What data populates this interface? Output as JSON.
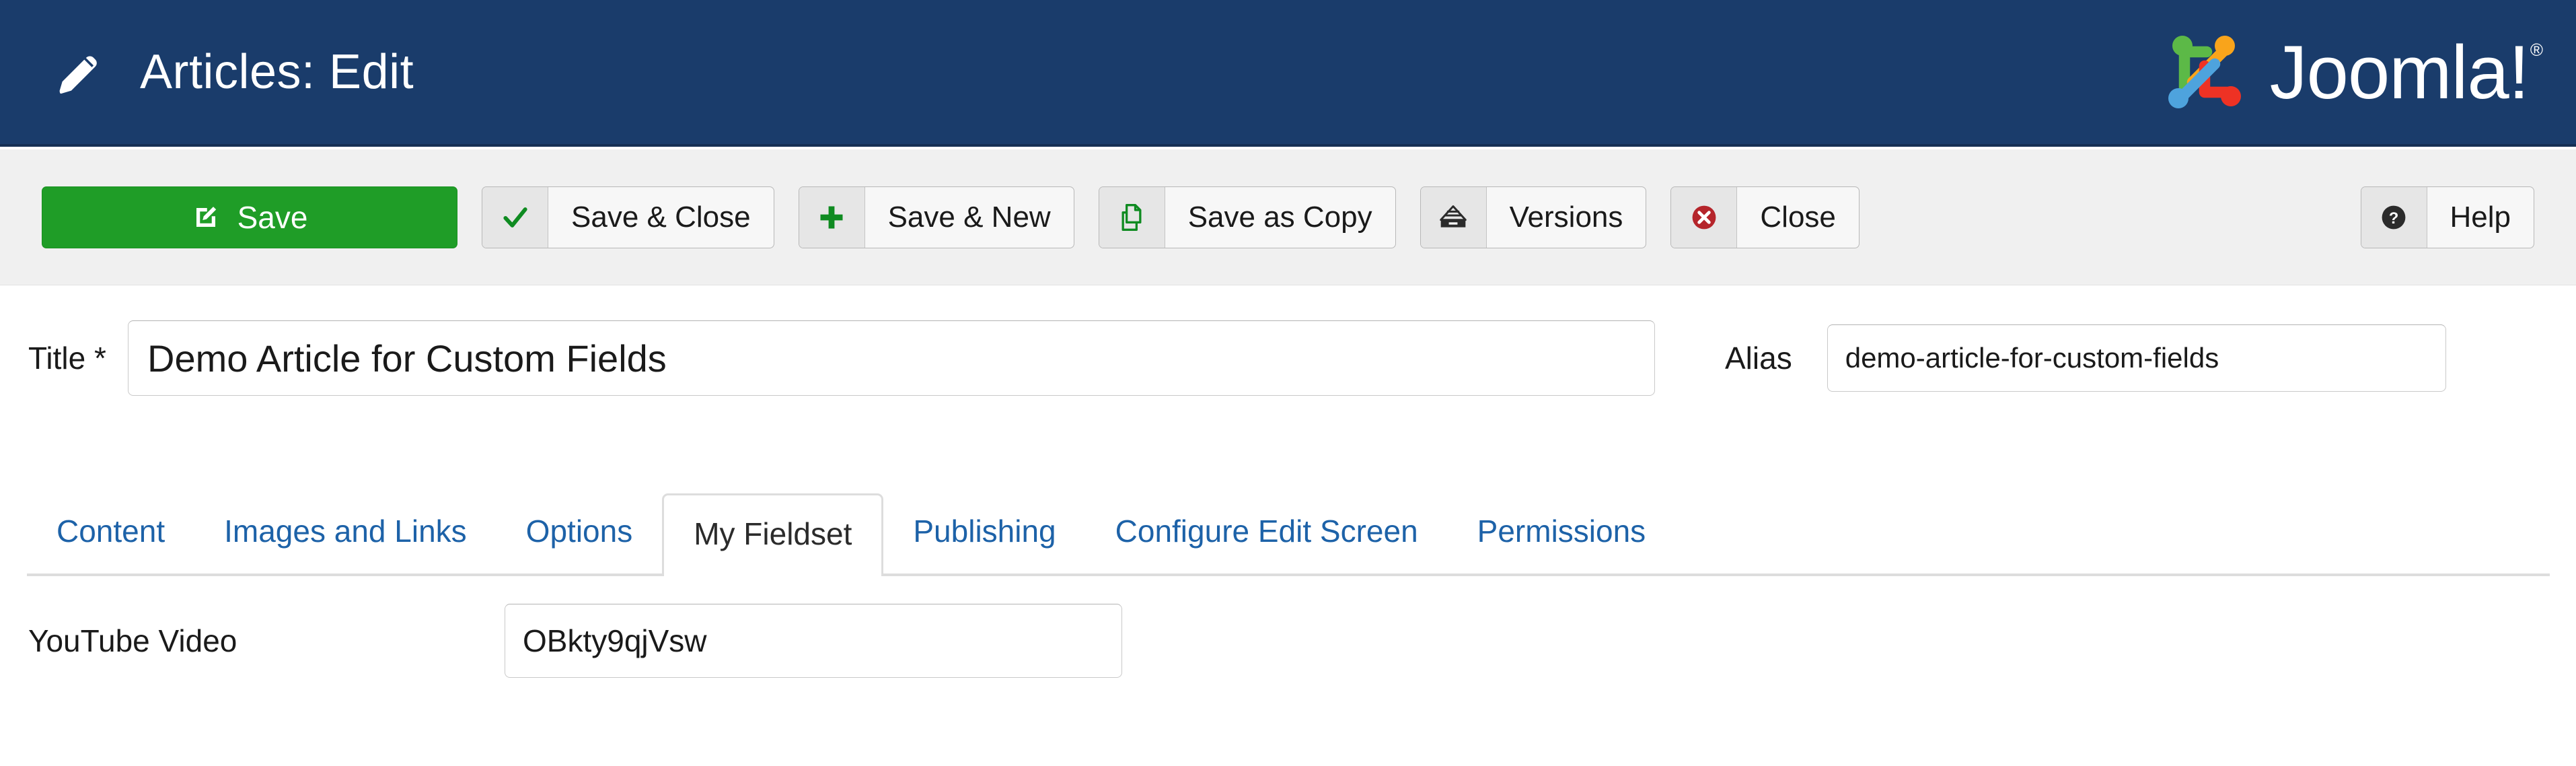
{
  "header": {
    "title": "Articles: Edit",
    "icon": "pencil-icon",
    "brand": "Joomla!",
    "brand_trademark": "®",
    "background_color": "#1a3c6b"
  },
  "toolbar": {
    "save": {
      "label": "Save",
      "icon": "edit-square-icon",
      "color": "#1f9d27"
    },
    "save_close": {
      "label": "Save & Close",
      "icon": "check-icon"
    },
    "save_new": {
      "label": "Save & New",
      "icon": "plus-icon"
    },
    "save_copy": {
      "label": "Save as Copy",
      "icon": "copy-documents-icon"
    },
    "versions": {
      "label": "Versions",
      "icon": "archive-drawer-icon"
    },
    "close": {
      "label": "Close",
      "icon": "close-circle-icon"
    },
    "help": {
      "label": "Help",
      "icon": "question-circle-icon"
    }
  },
  "form": {
    "title_label": "Title *",
    "title_value": "Demo Article for Custom Fields",
    "title_placeholder": "",
    "alias_label": "Alias",
    "alias_value": "demo-article-for-custom-fields",
    "alias_placeholder": ""
  },
  "tabs": [
    {
      "label": "Content",
      "active": false
    },
    {
      "label": "Images and Links",
      "active": false
    },
    {
      "label": "Options",
      "active": false
    },
    {
      "label": "My Fieldset",
      "active": true
    },
    {
      "label": "Publishing",
      "active": false
    },
    {
      "label": "Configure Edit Screen",
      "active": false
    },
    {
      "label": "Permissions",
      "active": false
    }
  ],
  "fieldset": {
    "youtube_label": "YouTube Video",
    "youtube_value": "OBkty9qjVsw",
    "youtube_placeholder": ""
  },
  "colors": {
    "header_blue": "#1a3c6b",
    "save_green": "#1f9d27",
    "link_blue": "#1d62a8",
    "toolbar_gray": "#f0f0f0",
    "danger_red": "#b5252b"
  }
}
